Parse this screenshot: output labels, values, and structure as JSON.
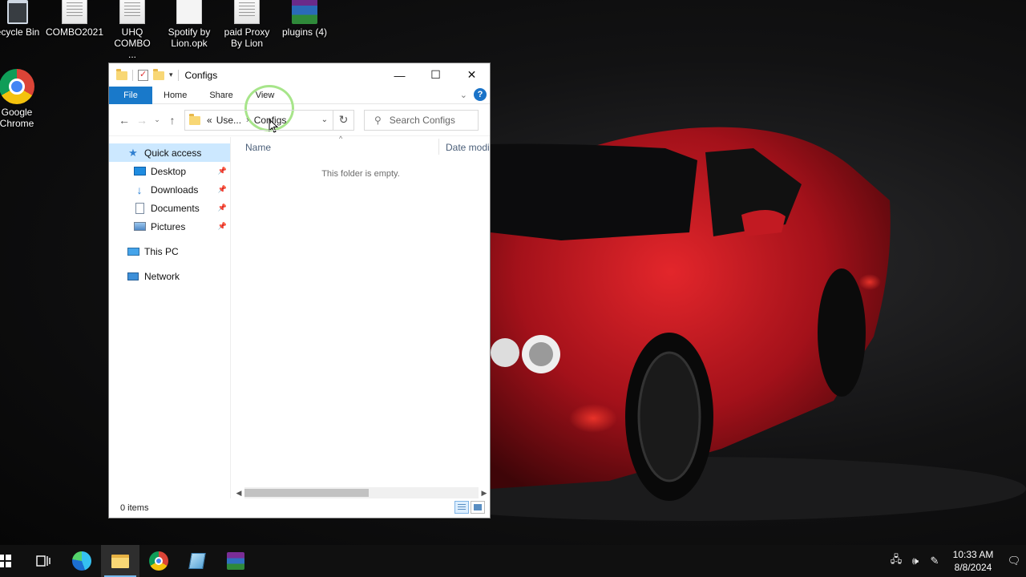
{
  "desktop": {
    "icons": [
      {
        "label": "ecycle Bin",
        "icon": "recycle-bin-icon"
      },
      {
        "label": "COMBO2021",
        "icon": "text-file-icon"
      },
      {
        "label": "UHQ COMBO ...",
        "icon": "text-file-icon"
      },
      {
        "label": "Spotify by Lion.opk",
        "icon": "file-icon"
      },
      {
        "label": "paid Proxy By Lion",
        "icon": "text-file-icon"
      },
      {
        "label": "plugins (4)",
        "icon": "winrar-icon"
      },
      {
        "label": "Google Chrome",
        "icon": "chrome-icon"
      }
    ]
  },
  "window": {
    "title": "Configs",
    "controls": {
      "minimize": "—",
      "maximize": "☐",
      "close": "✕"
    },
    "ribbon_tabs": [
      "File",
      "Home",
      "Share",
      "View"
    ],
    "address": {
      "parent": "Use...",
      "current": "Configs",
      "prefix": "«"
    },
    "search_placeholder": "Search Configs",
    "nav": {
      "quick_access": "Quick access",
      "items": [
        "Desktop",
        "Downloads",
        "Documents",
        "Pictures"
      ],
      "this_pc": "This PC",
      "network": "Network"
    },
    "columns": {
      "name": "Name",
      "date": "Date modi"
    },
    "empty_message": "This folder is empty.",
    "status": "0 items"
  },
  "taskbar": {
    "apps": [
      "start-icon",
      "task-view-icon",
      "edge-icon",
      "file-explorer-icon",
      "chrome-icon",
      "notepad-icon",
      "winrar-icon"
    ],
    "time": "10:33 AM",
    "date": "8/8/2024",
    "colors": {
      "accent": "#76b9ed",
      "file_tab": "#1979ca"
    }
  }
}
